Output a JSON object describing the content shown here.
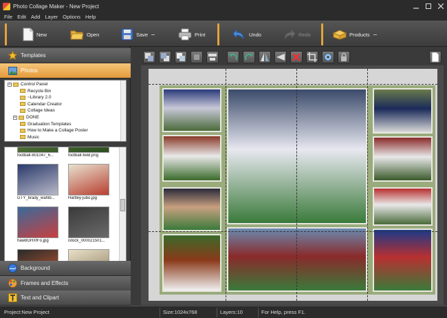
{
  "window": {
    "title": "Photo Collage Maker - New Project",
    "controls": [
      "minimize",
      "maximize",
      "close"
    ]
  },
  "menu": [
    "File",
    "Edit",
    "Add",
    "Layer",
    "Options",
    "Help"
  ],
  "toolbar": {
    "new_label": "New",
    "open_label": "Open",
    "save_label": "Save",
    "print_label": "Print",
    "undo_label": "Undo",
    "redo_label": "Redo",
    "products_label": "Products"
  },
  "left_panel": {
    "templates_label": "Templates",
    "photos_label": "Photos",
    "background_label": "Background",
    "frames_label": "Frames and Effects",
    "text_label": "Text and Clipart",
    "tree": [
      {
        "label": "Control Panel",
        "expander": "+"
      },
      {
        "label": "Recycle Bin",
        "expander": ""
      },
      {
        "label": "~Library 2.0",
        "expander": ""
      },
      {
        "label": "Calendar Creator",
        "expander": ""
      },
      {
        "label": "Collage Ideas",
        "expander": ""
      },
      {
        "label": "DONE",
        "expander": "+"
      },
      {
        "label": "Graduation Templates",
        "expander": ""
      },
      {
        "label": "How to Make a Collage Poster",
        "expander": ""
      },
      {
        "label": "Music",
        "expander": ""
      }
    ],
    "thumbnails": [
      {
        "caption": "football-801047_6...",
        "colors": [
          "#6a8a4a",
          "#3a5a2a"
        ]
      },
      {
        "caption": "football-field.png",
        "colors": [
          "#4f7a3a",
          "#2e4d22"
        ]
      },
      {
        "caption": "GTY_brady_wahlb...",
        "colors": [
          "#2a3a6a",
          "#b8b8c8"
        ]
      },
      {
        "caption": "Hartley-jubo.jpg",
        "colors": [
          "#e8e0d0",
          "#b84030"
        ]
      },
      {
        "caption": "haw8GHXfFo.jpg",
        "colors": [
          "#3a6a9a",
          "#c84040"
        ]
      },
      {
        "caption": "istock_000021501...",
        "colors": [
          "#3a3a3a",
          "#6a6a6a"
        ]
      },
      {
        "caption": "",
        "colors": [
          "#2a2a2a",
          "#c85a30"
        ]
      },
      {
        "caption": "",
        "colors": [
          "#e8e0c8",
          "#8a7a5a"
        ]
      }
    ]
  },
  "canvas_tools": [
    "bring-forward",
    "send-backward",
    "bring-to-front",
    "send-to-back",
    "align",
    "rotate-left",
    "rotate-right",
    "flip-horizontal",
    "flip-vertical",
    "delete",
    "crop",
    "settings",
    "lock",
    "page"
  ],
  "photos": [
    {
      "name": "photo-qb-throw",
      "colors": [
        "#2a3a7a",
        "#c8c8d8",
        "#4a6a3a"
      ]
    },
    {
      "name": "photo-receiver-catch",
      "colors": [
        "#8a3a2a",
        "#e8e8e8",
        "#3a6a2a"
      ]
    },
    {
      "name": "photo-kiss-field",
      "colors": [
        "#2a2a3a",
        "#c8a080",
        "#3a7a3a"
      ]
    },
    {
      "name": "photo-football-ball",
      "colors": [
        "#3a6a2a",
        "#8a3a1a",
        "#f0f0f0"
      ]
    },
    {
      "name": "photo-jump-stadium",
      "colors": [
        "#3a4a6a",
        "#e8e8f0",
        "#3a7a3a"
      ]
    },
    {
      "name": "photo-line-scrimmage",
      "colors": [
        "#6a8ab0",
        "#8a2a2a",
        "#3a7a3a"
      ]
    },
    {
      "name": "photo-helmet-grass",
      "colors": [
        "#6a7a4a",
        "#1a2a5a",
        "#d8d8d8"
      ]
    },
    {
      "name": "photo-red-tackle",
      "colors": [
        "#8a2a2a",
        "#e8e8e8",
        "#3a5a2a"
      ]
    },
    {
      "name": "photo-red-team",
      "colors": [
        "#b83030",
        "#e8e8e8",
        "#4a6a3a"
      ]
    },
    {
      "name": "photo-blue-red-play",
      "colors": [
        "#1a3a8a",
        "#b83030",
        "#3a7a3a"
      ]
    }
  ],
  "status": {
    "project": "Project:New Project",
    "size": "Size:1024x768",
    "layers": "Layers:10",
    "help": "For Help, press F1."
  },
  "colors": {
    "accent": "#e2a53a",
    "panel_active": "#eaa548"
  }
}
